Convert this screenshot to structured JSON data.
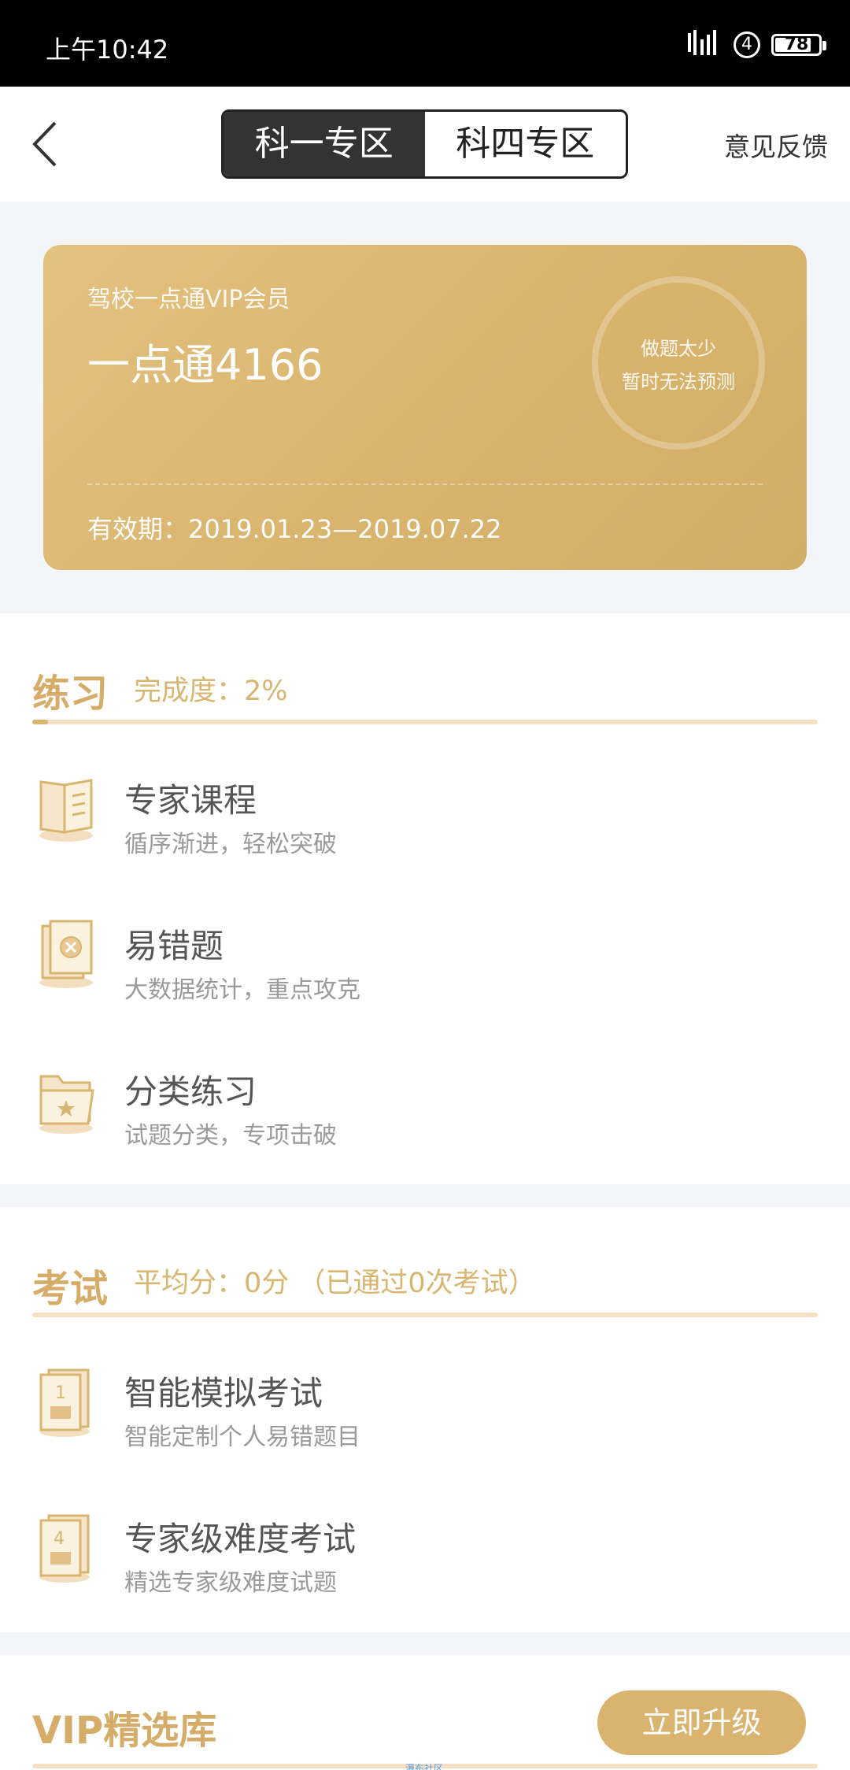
{
  "status_bar": {
    "time": "上午10:42",
    "sim_slot": "4",
    "battery": "78"
  },
  "nav": {
    "tabs": [
      {
        "label": "科一专区",
        "active": true
      },
      {
        "label": "科四专区",
        "active": false
      }
    ],
    "feedback": "意见反馈"
  },
  "vip_card": {
    "member_label": "驾校一点通VIP会员",
    "card_number": "一点通4166",
    "prediction_line1": "做题太少",
    "prediction_line2": "暂时无法预测",
    "validity": "有效期：2019.01.23—2019.07.22",
    "accent_color": "#d9b56e"
  },
  "practice": {
    "title": "练习",
    "completion": "完成度：2%",
    "progress": 0.02,
    "items": [
      {
        "title": "专家课程",
        "desc": "循序渐进，轻松突破",
        "icon": "book-icon"
      },
      {
        "title": "易错题",
        "desc": "大数据统计，重点攻克",
        "icon": "error-card-icon"
      },
      {
        "title": "分类练习",
        "desc": "试题分类，专项击破",
        "icon": "folder-star-icon"
      }
    ]
  },
  "exam": {
    "title": "考试",
    "summary": "平均分：0分 （已通过0次考试）",
    "items": [
      {
        "title": "智能模拟考试",
        "desc": "智能定制个人易错题目",
        "icon": "exam-1-icon"
      },
      {
        "title": "专家级难度考试",
        "desc": "精选专家级难度试题",
        "icon": "exam-4-icon"
      }
    ]
  },
  "vip_library": {
    "title": "VIP精选库",
    "upgrade_label": "立即升级"
  },
  "watermark": "瀑布社区"
}
